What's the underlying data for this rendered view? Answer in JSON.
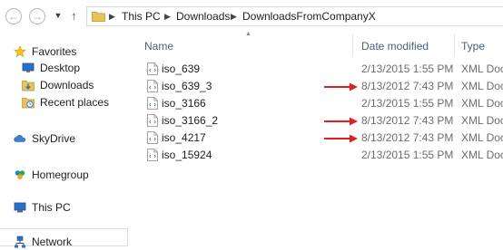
{
  "address_bar": {
    "crumbs": [
      "This PC",
      "Downloads",
      "DownloadsFromCompanyX"
    ]
  },
  "nav_pane": {
    "items": [
      {
        "label": "Favorites",
        "icon": "star-icon"
      },
      {
        "label": "Desktop",
        "icon": "desktop-icon"
      },
      {
        "label": "Downloads",
        "icon": "downloads-folder-icon"
      },
      {
        "label": "Recent places",
        "icon": "recent-places-icon"
      },
      {
        "label": "SkyDrive",
        "icon": "skydrive-icon"
      },
      {
        "label": "Homegroup",
        "icon": "homegroup-icon"
      },
      {
        "label": "This PC",
        "icon": "computer-icon"
      },
      {
        "label": "Network",
        "icon": "network-icon"
      }
    ]
  },
  "file_list": {
    "columns": {
      "name": "Name",
      "date": "Date modified",
      "type": "Type"
    },
    "rows": [
      {
        "name": "iso_639",
        "date": "2/13/2015 1:55 PM",
        "type": "XML Docu",
        "flagged": false
      },
      {
        "name": "iso_639_3",
        "date": "8/13/2012 7:43 PM",
        "type": "XML Docu",
        "flagged": true
      },
      {
        "name": "iso_3166",
        "date": "2/13/2015 1:55 PM",
        "type": "XML Docu",
        "flagged": false
      },
      {
        "name": "iso_3166_2",
        "date": "8/13/2012 7:43 PM",
        "type": "XML Docu",
        "flagged": true
      },
      {
        "name": "iso_4217",
        "date": "8/13/2012 7:43 PM",
        "type": "XML Docu",
        "flagged": true
      },
      {
        "name": "iso_15924",
        "date": "2/13/2015 1:55 PM",
        "type": "XML Docu",
        "flagged": false
      }
    ]
  },
  "colors": {
    "annotation_arrow": "#e02020",
    "column_header_text": "#4c607a",
    "secondary_text": "#6d6d6d",
    "folder_yellow": "#e8c458"
  }
}
